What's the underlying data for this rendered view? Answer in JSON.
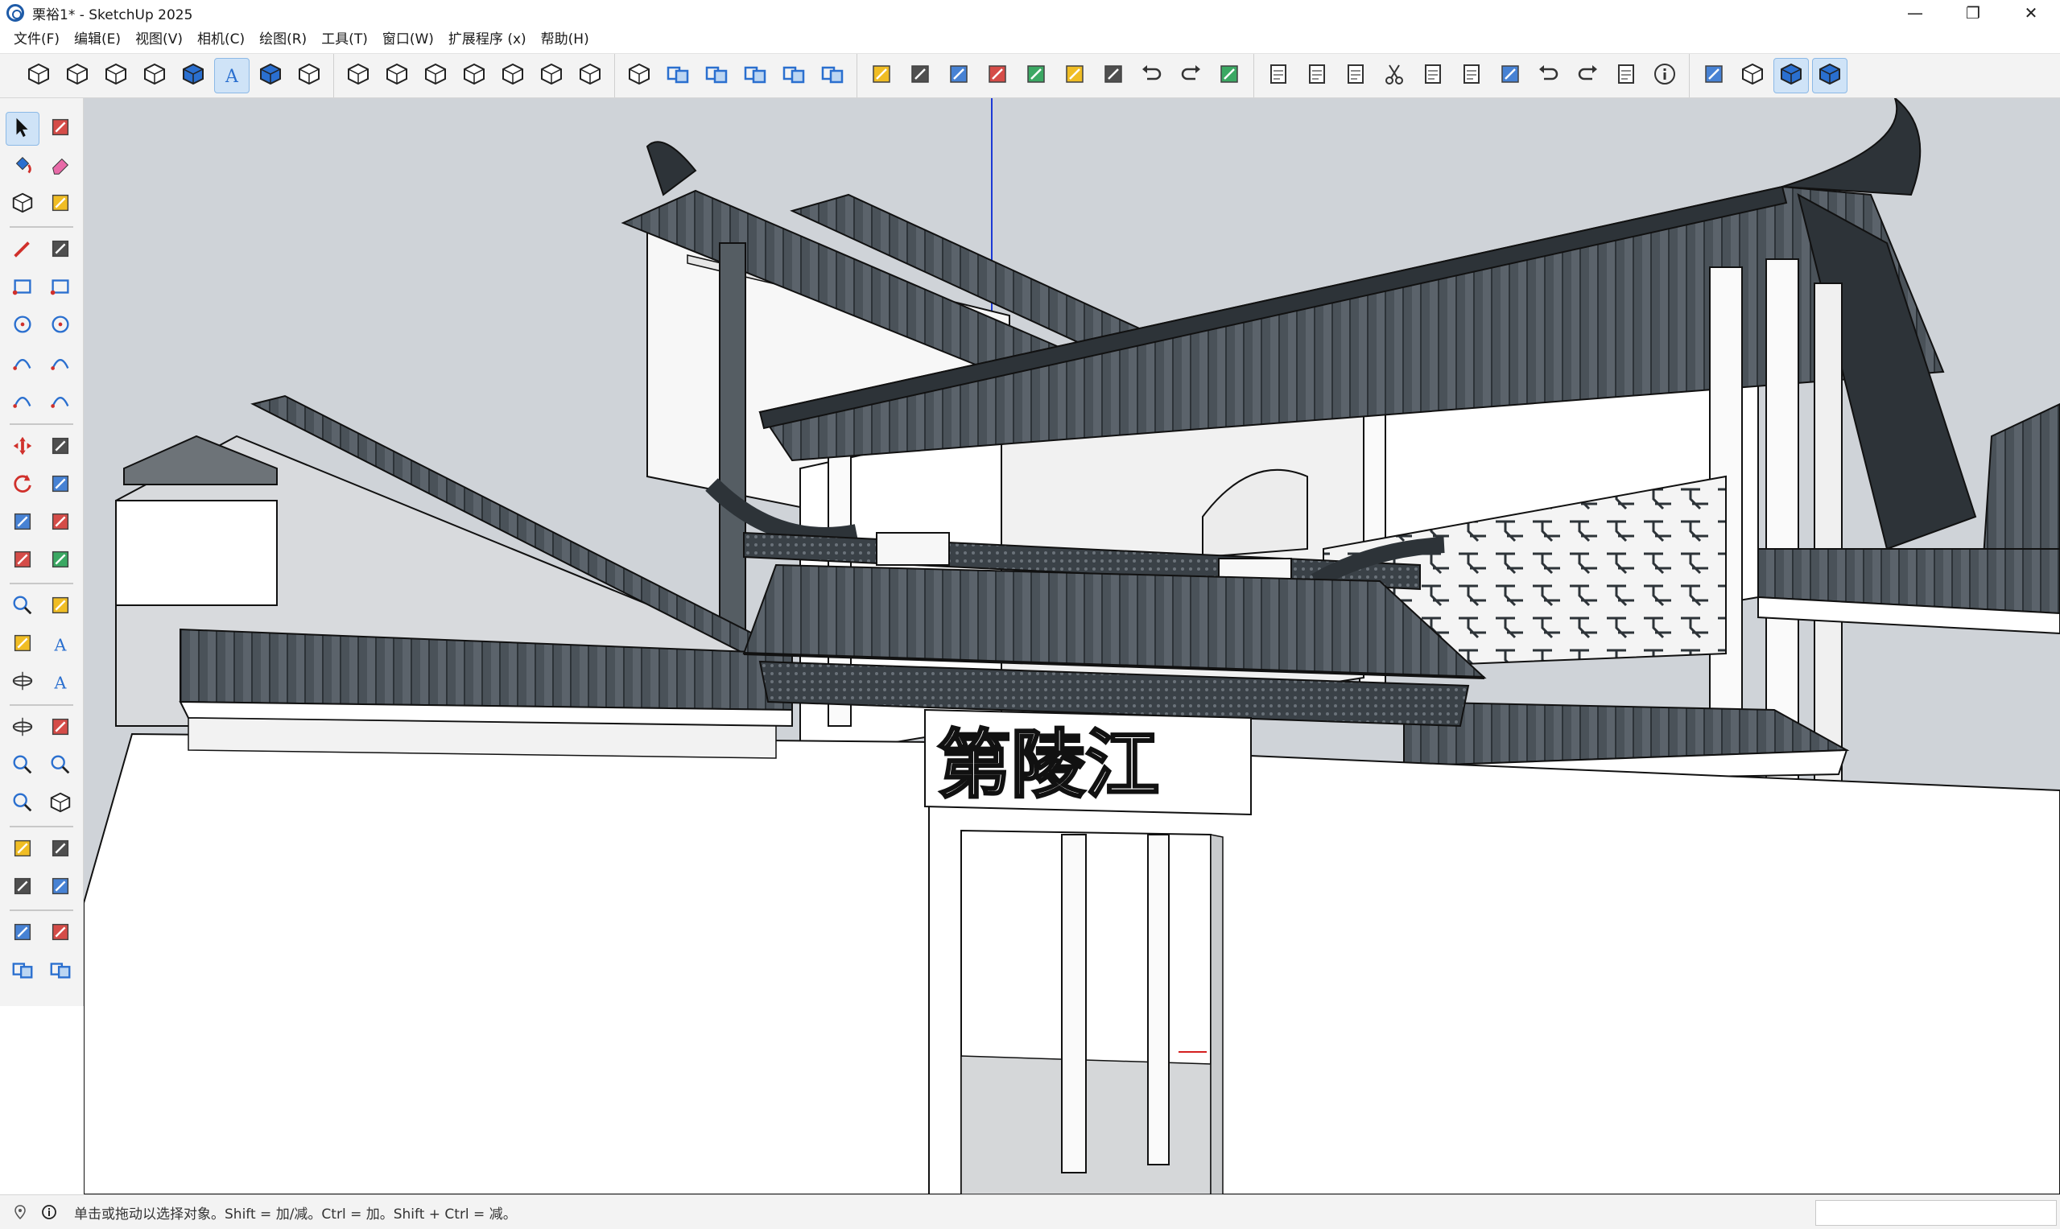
{
  "window": {
    "title": "栗裕1* - SketchUp 2025",
    "minimize_glyph": "—",
    "restore_glyph": "❐",
    "close_glyph": "✕"
  },
  "menu": [
    "文件(F)",
    "编辑(E)",
    "视图(V)",
    "相机(C)",
    "绘图(R)",
    "工具(T)",
    "窗口(W)",
    "扩展程序 (x)",
    "帮助(H)"
  ],
  "toolbar_groups": [
    {
      "name": "styles",
      "buttons": [
        "xray-style-icon",
        "backedges-style-icon",
        "wireframe-style-icon",
        "hiddenline-style-icon",
        "shaded-style-icon",
        "shaded-textures-style-icon",
        "monochrome-style-icon",
        "ambient-occlusion-style-icon"
      ],
      "active": [
        "shaded-textures-style-icon"
      ]
    },
    {
      "name": "views",
      "buttons": [
        "iso-view-icon",
        "top-view-icon",
        "front-view-icon",
        "right-view-icon",
        "back-view-icon",
        "left-view-icon",
        "bottom-view-icon"
      ],
      "active": []
    },
    {
      "name": "solids",
      "buttons": [
        "outer-shell-icon",
        "intersect-icon",
        "union-icon",
        "subtract-icon",
        "trim-icon",
        "split-icon"
      ],
      "active": []
    },
    {
      "name": "sandbox",
      "buttons": [
        "from-contours-icon",
        "from-scratch-icon",
        "smoove-icon",
        "stamp-icon",
        "drape-icon",
        "add-detail-icon",
        "flip-edge-icon",
        "undo-arrow-icon",
        "redo-arrow-icon",
        "delete-icon"
      ],
      "active": []
    },
    {
      "name": "standard",
      "buttons": [
        "new-file-icon",
        "open-file-icon",
        "save-icon",
        "cut-icon",
        "copy-icon",
        "paste-icon",
        "erase-icon",
        "undo-icon",
        "redo-icon",
        "print-icon",
        "model-info-icon"
      ],
      "active": []
    },
    {
      "name": "extras",
      "buttons": [
        "position-camera-icon",
        "components-icon",
        "warehouse-icon",
        "extension-warehouse-icon"
      ],
      "active": [
        "warehouse-icon",
        "extension-warehouse-icon"
      ]
    }
  ],
  "left_tools": [
    [
      "select-tool-icon",
      "lasso-select-icon"
    ],
    [
      "paint-bucket-icon",
      "eraser-icon"
    ],
    [
      "component-icon",
      "tag-tool-icon"
    ],
    [
      "line-tool-icon",
      "freehand-tool-icon"
    ],
    [
      "rectangle-tool-icon",
      "rotated-rectangle-icon"
    ],
    [
      "circle-tool-icon",
      "polygon-tool-icon"
    ],
    [
      "arc-tool-icon",
      "two-point-arc-icon"
    ],
    [
      "three-point-arc-icon",
      "pie-tool-icon"
    ],
    [
      "move-tool-icon",
      "push-pull-icon"
    ],
    [
      "rotate-tool-icon",
      "follow-me-icon"
    ],
    [
      "scale-tool-icon",
      "offset-tool-icon"
    ],
    [
      "flip-tool-icon",
      "section-plane-icon"
    ],
    [
      "tape-measure-icon",
      "dimension-icon"
    ],
    [
      "protractor-icon",
      "text-tool-icon"
    ],
    [
      "axes-tool-icon",
      "3d-text-icon"
    ],
    [
      "orbit-tool-icon",
      "pan-tool-icon"
    ],
    [
      "zoom-tool-icon",
      "zoom-window-icon"
    ],
    [
      "zoom-extents-icon",
      "previous-view-icon"
    ],
    [
      "position-camera-tool-icon",
      "walk-tool-icon"
    ],
    [
      "look-around-icon",
      "section-display-icon"
    ],
    [
      "sandbox-contours-icon",
      "sandbox-scratch-icon"
    ],
    [
      "layers-icon",
      "layers-settings-icon"
    ]
  ],
  "left_tool_active": "select-tool-icon",
  "model": {
    "signboard_text": "第陵江"
  },
  "status": {
    "hint": "单击或拖动以选择对象。Shift = 加/减。Ctrl = 加。Shift + Ctrl = 减。",
    "location_icon": "geo-location-icon",
    "info_icon": "info-icon"
  },
  "colors": {
    "sky": "#cfd3d8",
    "roof_tile": "#4a5259",
    "roof_dark": "#2d3338",
    "wall": "#ffffff",
    "accent_selected": "#cfe3f7",
    "axis_blue": "#1c39d6"
  }
}
